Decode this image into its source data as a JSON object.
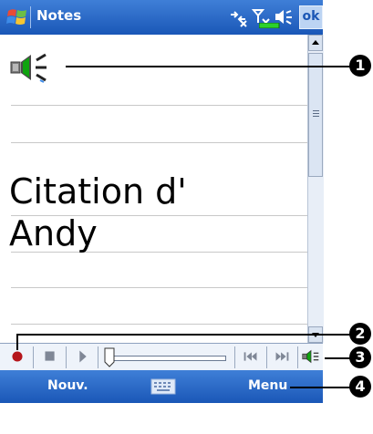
{
  "titlebar": {
    "app_title": "Notes",
    "ok_label": "ok",
    "icons": [
      "windows-logo-icon",
      "connectivity-icon",
      "signal-off-icon",
      "volume-icon",
      "battery-icon"
    ]
  },
  "note": {
    "lines": [
      "Citation d'",
      "Andy"
    ],
    "embedded_icon": "speaker-icon"
  },
  "toolbar": {
    "buttons": [
      "record-icon",
      "stop-icon",
      "play-icon",
      "skip-back-icon",
      "skip-forward-icon",
      "volume-icon"
    ]
  },
  "menubar": {
    "left_label": "Nouv.",
    "right_label": "Menu",
    "center_icon": "keyboard-icon"
  },
  "callouts": [
    "1",
    "2",
    "3",
    "4"
  ],
  "colors": {
    "titlebar": "#1a57b7",
    "record_dot": "#b5151b",
    "callout": "#000000"
  }
}
